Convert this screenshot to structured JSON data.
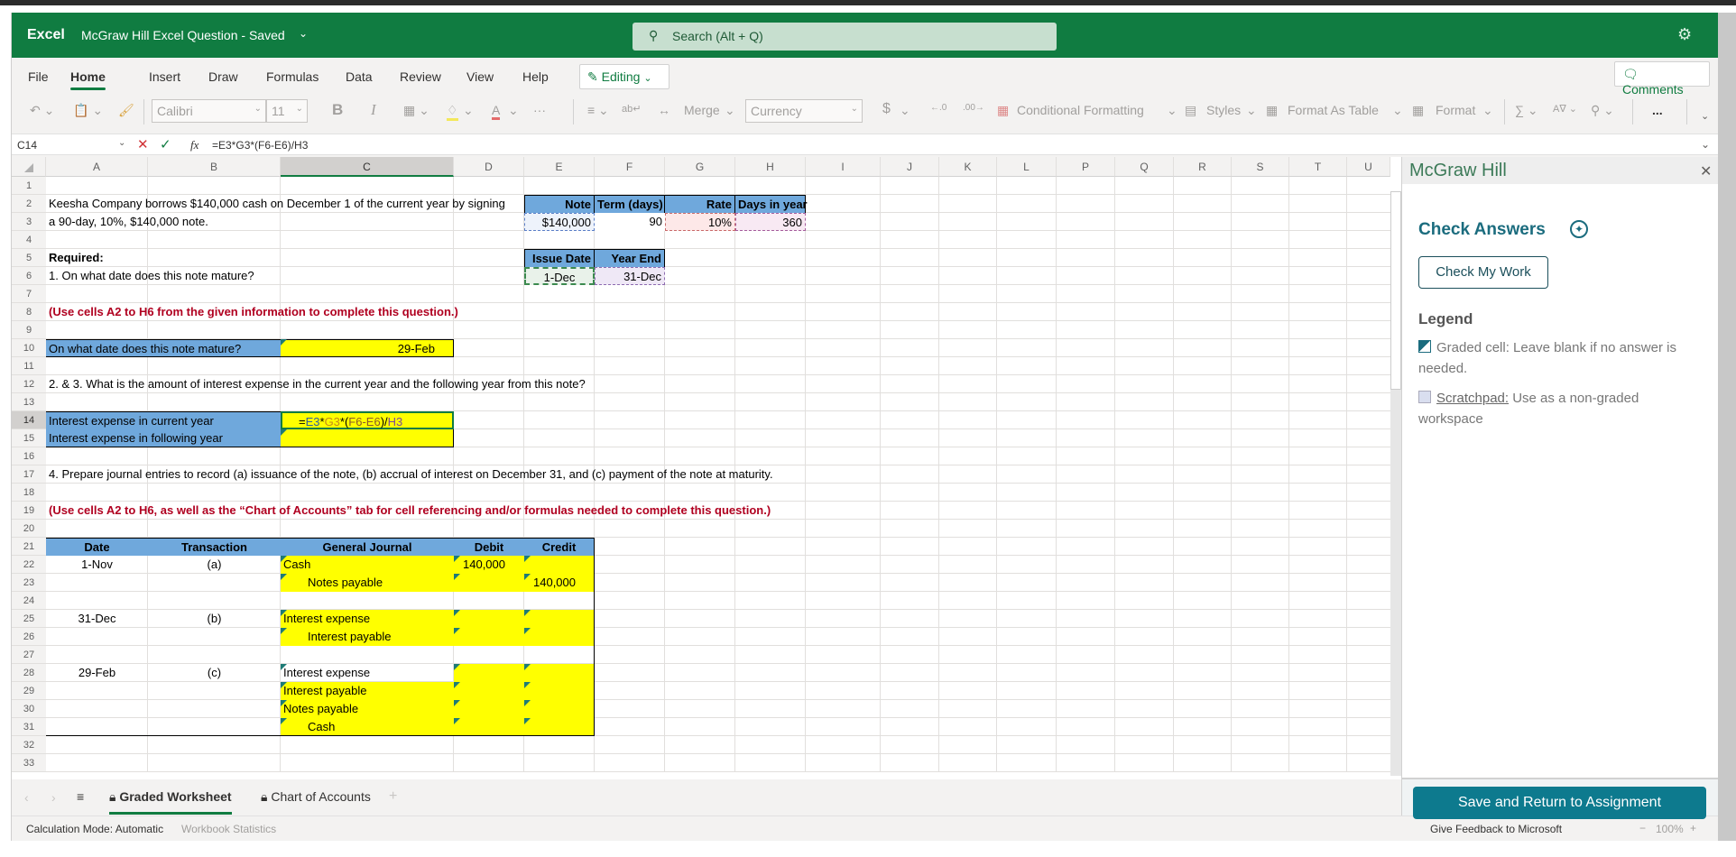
{
  "app": {
    "brand": "Excel",
    "document_title": "McGraw Hill Excel Question",
    "save_status": "Saved",
    "search_placeholder": "Search (Alt + Q)"
  },
  "menu_tabs": [
    {
      "label": "File"
    },
    {
      "label": "Home",
      "active": true
    },
    {
      "label": "Insert"
    },
    {
      "label": "Draw"
    },
    {
      "label": "Formulas"
    },
    {
      "label": "Data"
    },
    {
      "label": "Review"
    },
    {
      "label": "View"
    },
    {
      "label": "Help"
    }
  ],
  "mode_button": "Editing",
  "comments_button": "Comments",
  "ribbon": {
    "font_name": "Calibri",
    "font_size": "11",
    "bold": "B",
    "italic": "I",
    "merge": "Merge",
    "number_format": "Currency",
    "dollar": "$",
    "conditional_formatting": "Conditional Formatting",
    "styles": "Styles",
    "format_as_table": "Format As Table",
    "format": "Format",
    "more": "..."
  },
  "formula_bar": {
    "name_box": "C14",
    "fx": "fx",
    "formula": "=E3*G3*(F6-E6)/H3"
  },
  "columns": [
    "A",
    "B",
    "C",
    "D",
    "E",
    "F",
    "G",
    "H",
    "I",
    "J",
    "K",
    "L",
    "P",
    "Q",
    "R",
    "S",
    "T",
    "U"
  ],
  "selected_column": "C",
  "rows": [
    "1",
    "2",
    "3",
    "4",
    "5",
    "6",
    "7",
    "8",
    "9",
    "10",
    "11",
    "12",
    "13",
    "14",
    "15",
    "16",
    "17",
    "18",
    "19",
    "20",
    "21",
    "22",
    "23",
    "24",
    "25",
    "26",
    "27",
    "28",
    "29",
    "30",
    "31",
    "32",
    "33"
  ],
  "selected_row": "14",
  "sheet": {
    "r2": "Keesha Company borrows $140,000 cash on December 1 of the current year by signing",
    "r3": "a 90-day, 10%, $140,000 note.",
    "r5": "Required:",
    "r6": " 1. On what date does this note mature?",
    "r8": "(Use cells A2 to H6 from the given information to complete this question.)",
    "r10_label": "On what date does this note mature?",
    "r10_value": "29-Feb",
    "r12": "2. & 3. What is the amount of interest expense in the current year and the following year from this note?",
    "r14_label": "Interest expense in current year",
    "r14_formula_parts": [
      "=",
      "E3",
      "*",
      "G3",
      "*(",
      "F6-E6",
      ")/",
      "H3"
    ],
    "r15_label": "Interest expense in following year",
    "r17": "4. Prepare journal entries to record (a) issuance of the note, (b) accrual of interest on December 31, and (c) payment of the note at maturity.",
    "r19": "(Use cells A2 to H6, as well as the “Chart of Accounts” tab for cell referencing and/or formulas needed to complete this question.)",
    "given": {
      "headers1": [
        "Note",
        "Term (days)",
        "Rate",
        "Days in year"
      ],
      "values1": [
        "$140,000",
        "90",
        "10%",
        "360"
      ],
      "headers2": [
        "Issue Date",
        "Year End"
      ],
      "values2": [
        "1-Dec",
        "31-Dec"
      ]
    },
    "journal": {
      "headers": [
        "Date",
        "Transaction",
        "General Journal",
        "Debit",
        "Credit"
      ],
      "rows": [
        {
          "date": "1-Nov",
          "txn": "(a)",
          "account": "Cash",
          "indent": false,
          "debit": "140,000",
          "credit": ""
        },
        {
          "date": "",
          "txn": "",
          "account": "Notes payable",
          "indent": true,
          "debit": "",
          "credit": "140,000"
        },
        {
          "date": "",
          "txn": "",
          "account": "",
          "indent": false,
          "debit": "",
          "credit": "",
          "blank": true
        },
        {
          "date": "31-Dec",
          "txn": "(b)",
          "account": "Interest expense",
          "indent": false,
          "debit": "",
          "credit": ""
        },
        {
          "date": "",
          "txn": "",
          "account": "Interest payable",
          "indent": true,
          "debit": "",
          "credit": ""
        },
        {
          "date": "",
          "txn": "",
          "account": "",
          "indent": false,
          "debit": "",
          "credit": "",
          "blank": true
        },
        {
          "date": "29-Feb",
          "txn": "(c)",
          "account": "Interest expense",
          "indent": false,
          "debit": "",
          "credit": "",
          "white_account": true
        },
        {
          "date": "",
          "txn": "",
          "account": "Interest payable",
          "indent": false,
          "debit": "",
          "credit": ""
        },
        {
          "date": "",
          "txn": "",
          "account": "Notes payable",
          "indent": false,
          "debit": "",
          "credit": ""
        },
        {
          "date": "",
          "txn": "",
          "account": "Cash",
          "indent": true,
          "debit": "",
          "credit": ""
        }
      ]
    }
  },
  "sheet_tabs": [
    {
      "label": "Graded Worksheet",
      "active": true,
      "locked": true
    },
    {
      "label": "Chart of Accounts",
      "active": false,
      "locked": true
    }
  ],
  "status_bar": {
    "calc_mode": "Calculation Mode: Automatic",
    "workbook_stats": "Workbook Statistics",
    "feedback": "Give Feedback to Microsoft",
    "zoom": "100%"
  },
  "pane": {
    "title": "McGraw Hill",
    "check_answers": "Check Answers",
    "check_button": "Check My Work",
    "legend_title": "Legend",
    "legend_graded": "Graded cell: Leave blank if no answer is needed.",
    "legend_scratch_link": "Scratchpad:",
    "legend_scratch_text": " Use as a non-graded workspace",
    "save_button": "Save and Return to Assignment"
  },
  "colors": {
    "excel_green": "#107c41",
    "header_blue": "#6fa8dc",
    "input_yellow": "#ffff00",
    "mh_teal": "#0d7a8e",
    "instruction_red": "#b00020"
  }
}
